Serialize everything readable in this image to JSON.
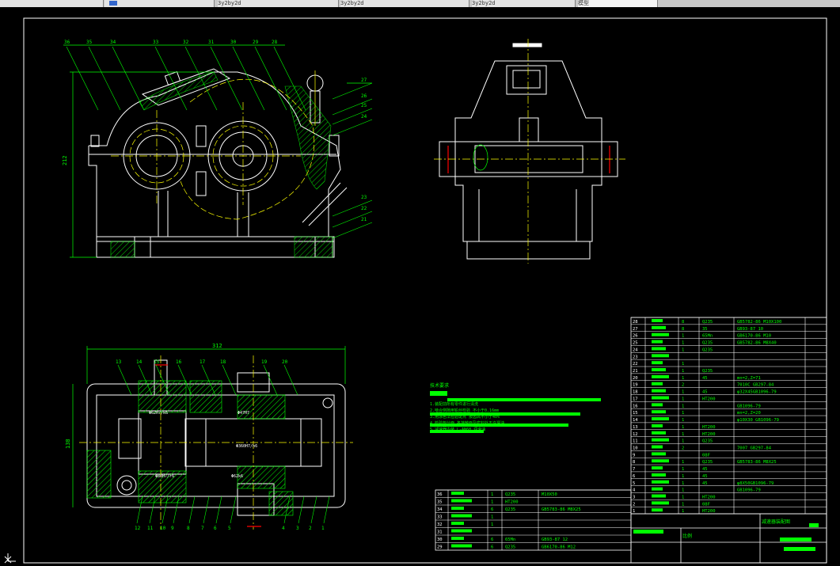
{
  "window": {
    "tabs": [
      {
        "label": ""
      },
      {
        "label": ""
      },
      {
        "label": "3y2by2d"
      },
      {
        "label": "3y2by2d"
      },
      {
        "label": "3y2by2d"
      },
      {
        "label": "模型"
      }
    ]
  },
  "drawing": {
    "colors": {
      "background": "#000000",
      "outline": "#ffffff",
      "dimension": "#00ff00",
      "center": "#ffff00",
      "hatch": "#00ff00",
      "highlight": "#ff0000",
      "cyan": "#00ffff"
    },
    "front_view": {
      "overall_height": "212",
      "callouts_top": [
        "36",
        "35",
        "34",
        "33",
        "32",
        "31",
        "30",
        "29",
        "28"
      ],
      "callouts_right": [
        "27",
        "26",
        "25",
        "24",
        "23",
        "22",
        "21"
      ]
    },
    "side_view": {
      "label": ""
    },
    "top_view": {
      "overall_width": "312",
      "overall_depth": "138",
      "callouts_top": [
        "13",
        "14",
        "15",
        "16",
        "17",
        "18",
        "19",
        "20"
      ],
      "callouts_bottom": [
        "12",
        "11",
        "10",
        "9",
        "8",
        "7",
        "6",
        "5",
        "4",
        "3",
        "2",
        "1"
      ],
      "dims": [
        "Φ62H7/k6",
        "Φ47H7",
        "Φ360H7/h6",
        "Φ80H7/r6",
        "Φ62k6"
      ]
    },
    "notes": {
      "title": "技术要求",
      "lines": [
        "1.装配前所有零件进行清洗",
        "2.啮合侧隙用铅丝检验 不小于0.16mm",
        "3.用涂色法检验斑点 按齿高不小于40%",
        "4.检验剖分面 各接触面及密封处不许漏油",
        "5.减速器内装 L-AN68 润滑油"
      ]
    },
    "parts_list_right": [
      {
        "no": "28",
        "name": "螺栓",
        "qty": "8",
        "mat": "Q235",
        "std": "GB5782-86 M10X100"
      },
      {
        "no": "27",
        "name": "弹簧垫圈",
        "qty": "8",
        "mat": "35",
        "std": "GB93-87 10"
      },
      {
        "no": "26",
        "name": "螺母",
        "qty": "1",
        "mat": "65Mn",
        "std": "GB6170-86 M10"
      },
      {
        "no": "25",
        "name": "垫片",
        "qty": "1",
        "mat": "Q235",
        "std": "GB5782-86 M8X40"
      },
      {
        "no": "24",
        "name": "螺栓",
        "qty": "1",
        "mat": "Q235",
        "std": ""
      },
      {
        "no": "23",
        "name": "",
        "qty": "",
        "mat": "",
        "std": ""
      },
      {
        "no": "22",
        "name": "",
        "qty": "1",
        "mat": "",
        "std": ""
      },
      {
        "no": "21",
        "name": "",
        "qty": "1",
        "mat": "Q235",
        "std": ""
      },
      {
        "no": "20",
        "name": "",
        "qty": "1",
        "mat": "45",
        "std": "mn=2,Z=71"
      },
      {
        "no": "19",
        "name": "",
        "qty": "2",
        "mat": "",
        "std": "7010C GB297-84"
      },
      {
        "no": "18",
        "name": "",
        "qty": "1",
        "mat": "45",
        "std": "φ32X45GB1096-79"
      },
      {
        "no": "17",
        "name": "",
        "qty": "1",
        "mat": "HT200",
        "std": ""
      },
      {
        "no": "16",
        "name": "",
        "qty": "1",
        "mat": "",
        "std": "GB1096-79"
      },
      {
        "no": "15",
        "name": "",
        "qty": "1",
        "mat": "",
        "std": "mn=2,Z=20"
      },
      {
        "no": "14",
        "name": "",
        "qty": "1",
        "mat": "",
        "std": "φ10X30 GB1096-79"
      },
      {
        "no": "13",
        "name": "",
        "qty": "1",
        "mat": "HT200",
        "std": ""
      },
      {
        "no": "12",
        "name": "",
        "qty": "1",
        "mat": "HT200",
        "std": ""
      },
      {
        "no": "11",
        "name": "",
        "qty": "1",
        "mat": "Q235",
        "std": ""
      },
      {
        "no": "10",
        "name": "",
        "qty": "2",
        "mat": "",
        "std": "7007 GB297-84"
      },
      {
        "no": "9",
        "name": "",
        "qty": "",
        "mat": "08F",
        "std": ""
      },
      {
        "no": "8",
        "name": "",
        "qty": "1",
        "mat": "Q235",
        "std": "GB5783-86 M8X25"
      },
      {
        "no": "7",
        "name": "",
        "qty": "1",
        "mat": "45",
        "std": ""
      },
      {
        "no": "6",
        "name": "",
        "qty": "1",
        "mat": "45",
        "std": ""
      },
      {
        "no": "5",
        "name": "",
        "qty": "1",
        "mat": "45",
        "std": "φ8X50GB1096-79"
      },
      {
        "no": "4",
        "name": "",
        "qty": "1",
        "mat": "",
        "std": "GB1096-79"
      },
      {
        "no": "3",
        "name": "",
        "qty": "1",
        "mat": "HT200",
        "std": ""
      },
      {
        "no": "2",
        "name": "",
        "qty": "1",
        "mat": "08F",
        "std": ""
      },
      {
        "no": "1",
        "name": "",
        "qty": "1",
        "mat": "HT200",
        "std": ""
      }
    ],
    "parts_list_left": [
      {
        "no": "36",
        "name": "",
        "qty": "1",
        "mat": "Q235",
        "std": "M10X50"
      },
      {
        "no": "35",
        "name": "",
        "qty": "1",
        "mat": "HT200",
        "std": ""
      },
      {
        "no": "34",
        "name": "",
        "qty": "6",
        "mat": "Q235",
        "std": "GB5783-86 M8X25"
      },
      {
        "no": "33",
        "name": "",
        "qty": "1",
        "mat": "",
        "std": ""
      },
      {
        "no": "32",
        "name": "",
        "qty": "1",
        "mat": "",
        "std": ""
      },
      {
        "no": "31",
        "name": "",
        "qty": "",
        "mat": "",
        "std": ""
      },
      {
        "no": "30",
        "name": "",
        "qty": "6",
        "mat": "65Mn",
        "std": "GB93-87 12"
      },
      {
        "no": "29",
        "name": "",
        "qty": "6",
        "mat": "Q235",
        "std": "GB6170-86 M12"
      }
    ],
    "title_block": {
      "label_1": "减速器装配图",
      "label_2": "比例",
      "label_3": "",
      "label_4": "",
      "label_5": ""
    }
  }
}
